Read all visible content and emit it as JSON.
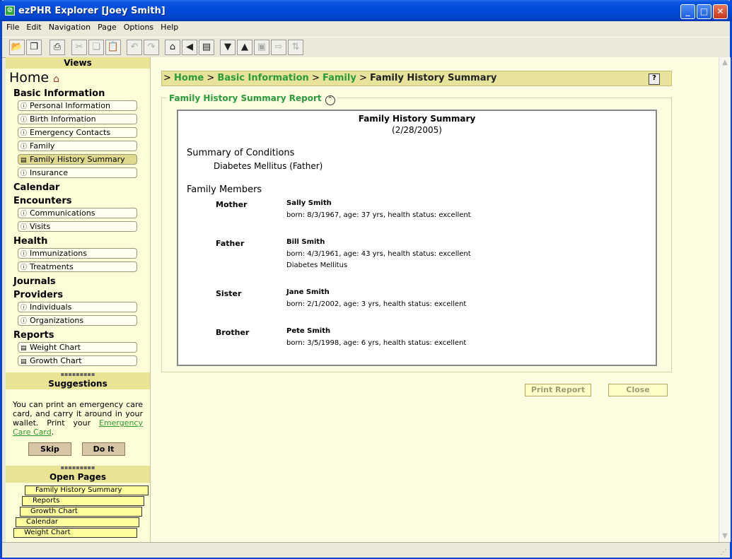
{
  "window": {
    "title": "ezPHR Explorer [Joey Smith]"
  },
  "menu": [
    "File",
    "Edit",
    "Navigation",
    "Page",
    "Options",
    "Help"
  ],
  "sidebar": {
    "views_label": "Views",
    "home_label": "Home",
    "basic_info": {
      "label": "Basic Information",
      "items": [
        "Personal Information",
        "Birth Information",
        "Emergency Contacts",
        "Family",
        "Family History Summary",
        "Insurance"
      ]
    },
    "calendar": "Calendar",
    "encounters": {
      "label": "Encounters",
      "items": [
        "Communications",
        "Visits"
      ]
    },
    "health": {
      "label": "Health",
      "items": [
        "Immunizations",
        "Treatments"
      ]
    },
    "journals": "Journals",
    "providers": {
      "label": "Providers",
      "items": [
        "Individuals",
        "Organizations"
      ]
    },
    "reports": {
      "label": "Reports",
      "items": [
        "Weight Chart",
        "Growth Chart"
      ]
    },
    "grip": "▪▪▪▪▪▪▪▪▪",
    "suggestions_label": "Suggestions",
    "suggestion_text": "You can print an emergency care card, and carry it around in your wallet. Print your",
    "suggestion_link": "Emergency Care Card",
    "suggestion_end": ".",
    "skip_label": "Skip",
    "doit_label": "Do It",
    "open_pages_label": "Open Pages",
    "open_pages": [
      "Family History Summary",
      "Reports",
      "Growth Chart",
      "Calendar",
      "Weight Chart"
    ]
  },
  "breadcrumb": {
    "sep": ">",
    "home": "Home",
    "basic": "Basic Information",
    "family": "Family",
    "current": "Family History Summary"
  },
  "report": {
    "legend": "Family History Summary Report",
    "title": "Family History Summary",
    "date": "(2/28/2005)",
    "conditions_heading": "Summary of Conditions",
    "condition": "Diabetes Mellitus (Father)",
    "members_heading": "Family Members",
    "members": [
      {
        "relation": "Mother",
        "name": "Sally Smith",
        "details": "born: 8/3/1967, age: 37 yrs, health status: excellent",
        "extra": ""
      },
      {
        "relation": "Father",
        "name": "Bill Smith",
        "details": "born: 4/3/1961, age: 43 yrs, health status: excellent",
        "extra": "Diabetes Mellitus"
      },
      {
        "relation": "Sister",
        "name": "Jane Smith",
        "details": "born: 2/1/2002, age: 3 yrs, health status: excellent",
        "extra": ""
      },
      {
        "relation": "Brother",
        "name": "Pete Smith",
        "details": "born: 3/5/1998, age: 6 yrs, health status: excellent",
        "extra": ""
      }
    ]
  },
  "actions": {
    "print_label": "Print Report",
    "close_label": "Close"
  }
}
